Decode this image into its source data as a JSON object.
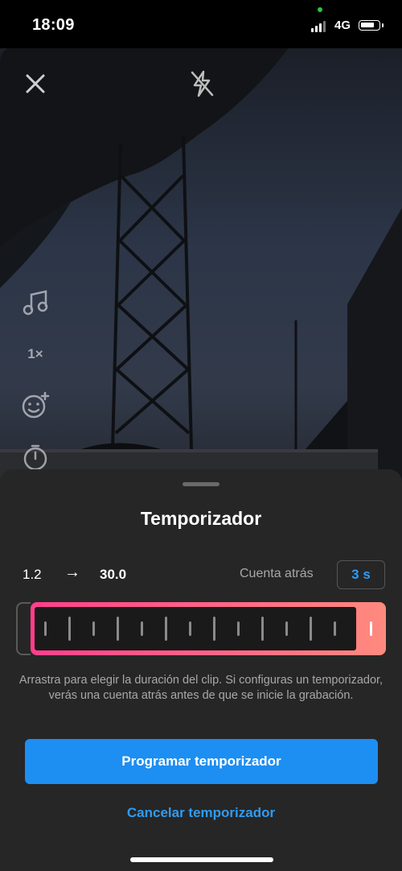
{
  "status_bar": {
    "time": "18:09",
    "network": "4G",
    "battery_level": 0.7
  },
  "camera": {
    "close_icon": "close-icon",
    "flash_icon": "flash-off-icon",
    "side_tools": [
      {
        "icon": "music-icon"
      },
      {
        "label": "1×",
        "icon": "speed-icon"
      },
      {
        "icon": "effects-icon"
      },
      {
        "icon": "timer-icon"
      }
    ]
  },
  "sheet": {
    "title": "Temporizador",
    "start_value": "1.2",
    "arrow": "→",
    "end_value": "30.0",
    "countdown_label": "Cuenta atrás",
    "countdown_value": "3 s",
    "helper_text": "Arrastra para elegir la duración del clip. Si configuras un temporizador, verás una cuenta atrás antes de que se inicie la grabación.",
    "primary_button": "Programar temporizador",
    "secondary_button": "Cancelar temporizador"
  },
  "colors": {
    "accent_blue": "#1d8ef2",
    "link_blue": "#2f9bf5",
    "selection_gradient_start": "#ff3f8c",
    "selection_gradient_end": "#ff8a7e",
    "sheet_bg": "#262626"
  }
}
